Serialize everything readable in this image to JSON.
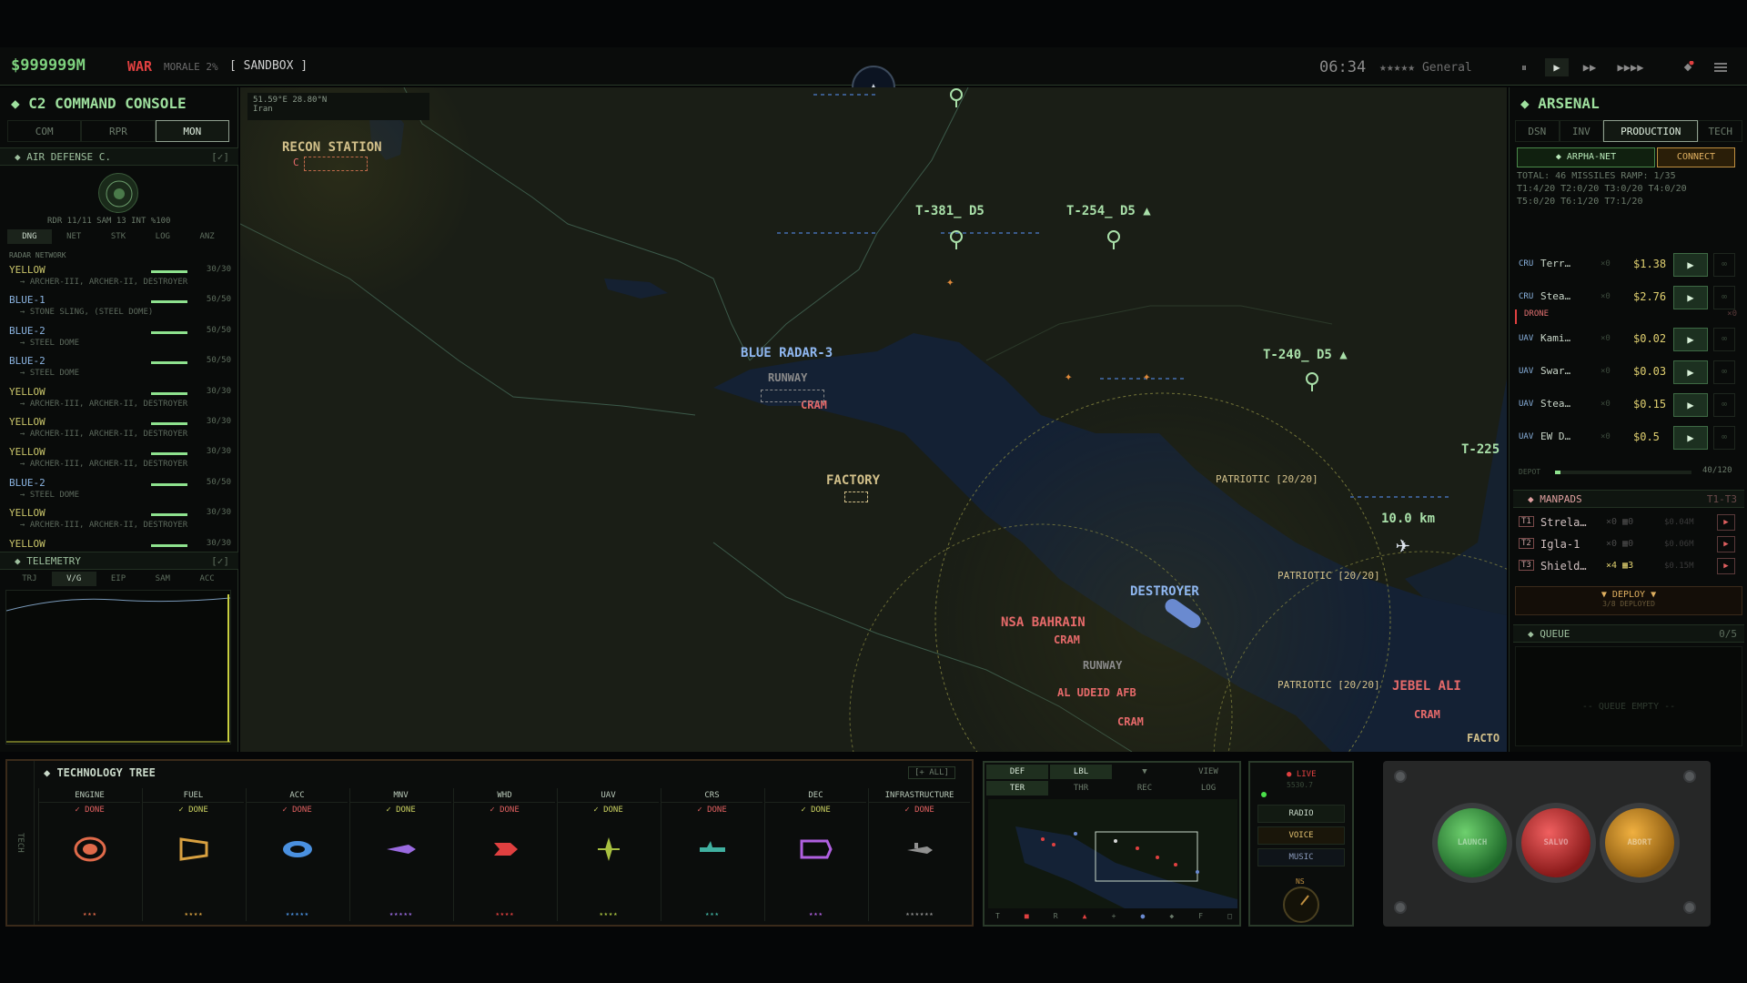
{
  "topbar": {
    "money": "$999999M",
    "war": "WAR",
    "morale": "MORALE 2%",
    "mode": "[ SANDBOX ]",
    "clock": "06:34",
    "rank": "★★★★★ General",
    "controls": [
      "⏸",
      "▶",
      "▶▶",
      "▶▶▶▶"
    ],
    "menu_icon": "menu-icon",
    "alert_icon": "satellite-icon"
  },
  "left": {
    "title": "C2 COMMAND CONSOLE",
    "tabs": [
      "COM",
      "RPR",
      "MON"
    ],
    "active_tab": 2,
    "section": "AIR DEFENSE C.",
    "section_check": "[✓]",
    "status_line": "RDR 11/11  SAM 13  INT %100",
    "subtabs": [
      "DNG",
      "NET",
      "STK",
      "LOG",
      "ANZ"
    ],
    "radar_header": "RADAR NETWORK",
    "radars": [
      {
        "name": "YELLOW",
        "val": "30/30",
        "sub": "→ ARCHER-III, ARCHER-II, DESTROYER",
        "blue": false
      },
      {
        "name": "BLUE-1",
        "val": "50/50",
        "sub": "→ STONE SLING, (STEEL DOME)",
        "blue": true
      },
      {
        "name": "BLUE-2",
        "val": "50/50",
        "sub": "→ STEEL DOME",
        "blue": true
      },
      {
        "name": "BLUE-2",
        "val": "50/50",
        "sub": "→ STEEL DOME",
        "blue": true
      },
      {
        "name": "YELLOW",
        "val": "30/30",
        "sub": "→ ARCHER-III, ARCHER-II, DESTROYER",
        "blue": false
      },
      {
        "name": "YELLOW",
        "val": "30/30",
        "sub": "→ ARCHER-III, ARCHER-II, DESTROYER",
        "blue": false
      },
      {
        "name": "YELLOW",
        "val": "30/30",
        "sub": "→ ARCHER-III, ARCHER-II, DESTROYER",
        "blue": false
      },
      {
        "name": "BLUE-2",
        "val": "50/50",
        "sub": "→ STEEL DOME",
        "blue": true
      },
      {
        "name": "YELLOW",
        "val": "30/30",
        "sub": "→ ARCHER-III, ARCHER-II, DESTROYER",
        "blue": false
      },
      {
        "name": "YELLOW",
        "val": "30/30",
        "sub": "",
        "blue": false
      }
    ],
    "telemetry": "TELEMETRY",
    "telemetry_check": "[✓]",
    "tele_tabs": [
      "TRJ",
      "V/G",
      "EIP",
      "SAM",
      "ACC"
    ]
  },
  "map": {
    "coords": "51.59°E 28.80°N",
    "country": "Iran",
    "labels": {
      "recon": "RECON STATION",
      "t381": "T-381_ D5",
      "t254": "T-254_ D5 ▲",
      "t240": "T-240_ D5 ▲",
      "t225": "T-225",
      "blue_radar": "BLUE RADAR-3",
      "runway1": "RUNWAY",
      "cram1": "CRAM",
      "factory": "FACTORY",
      "patriot1": "PATRIOTIC [20/20]",
      "patriot2": "PATRIOTIC [20/20]",
      "patriot3": "PATRIOTIC [20/20]",
      "distance": "10.0 km",
      "destroyer": "DESTROYER",
      "nsa": "NSA BAHRAIN",
      "cram2": "CRAM",
      "runway2": "RUNWAY",
      "afb": "AL UDEID AFB",
      "cram3": "CRAM",
      "jebel": "JEBEL ALI",
      "cram4": "CRAM",
      "facto": "FACTO",
      "c_mark": "C"
    }
  },
  "right": {
    "title": "ARSENAL",
    "tabs": [
      "DSN",
      "INV",
      "PRODUCTION",
      "TECH"
    ],
    "active_tab": 2,
    "net": "◆ ARPHA-NET",
    "connect": "CONNECT",
    "totals1": "TOTAL: 46 MISSILES RAMP: 1/35",
    "totals2": "T1:4/20 T2:0/20 T3:0/20 T4:0/20",
    "totals3": "T5:0/20 T6:1/20 T7:1/20",
    "cruise": [
      {
        "type": "CRU",
        "name": "Terr…",
        "cnt": "×0",
        "price": "$1.38"
      },
      {
        "type": "CRU",
        "name": "Stea…",
        "cnt": "×0",
        "price": "$2.76"
      }
    ],
    "drone_header": "DRONE",
    "drone_count": "×0",
    "drones": [
      {
        "type": "UAV",
        "name": "Kami…",
        "cnt": "×0",
        "price": "$0.02"
      },
      {
        "type": "UAV",
        "name": "Swar…",
        "cnt": "×0",
        "price": "$0.03"
      },
      {
        "type": "UAV",
        "name": "Stea…",
        "cnt": "×0",
        "price": "$0.15"
      },
      {
        "type": "UAV",
        "name": "EW D…",
        "cnt": "×0",
        "price": "$0.5"
      }
    ],
    "depot": "DEPOT",
    "depot_val": "40/120",
    "depot_fraction": 0.04,
    "manpads": "MANPADS",
    "manpads_tier": "T1-T3",
    "manpad_rows": [
      {
        "tier": "T1",
        "name": "Strela…",
        "cnt": "×0 ▦0",
        "price": "$0.04M"
      },
      {
        "tier": "T2",
        "name": "Igla-1",
        "cnt": "×0 ▦0",
        "price": "$0.06M"
      },
      {
        "tier": "T3",
        "name": "Shield…",
        "cnt": "×4 ▦3",
        "price": "$0.15M"
      }
    ],
    "deploy": "▼ DEPLOY ▼",
    "deployed": "3/8 DEPLOYED",
    "queue": "QUEUE",
    "queue_count": "0/5",
    "queue_empty": "-- QUEUE EMPTY --"
  },
  "tech": {
    "title": "TECHNOLOGY TREE",
    "all": "[+ ALL]",
    "side": "TECH",
    "columns": [
      {
        "name": "ENGINE",
        "status": "✓ DONE",
        "color": "#e06a4a",
        "stars": "★★★",
        "icon": "engine-icon"
      },
      {
        "name": "FUEL",
        "status": "✓ DONE",
        "color": "#d8a040",
        "stars": "★★★★",
        "icon": "fuel-icon"
      },
      {
        "name": "ACC",
        "status": "✓ DONE",
        "color": "#4a90e0",
        "stars": "★★★★★",
        "icon": "accuracy-icon"
      },
      {
        "name": "MNV",
        "status": "✓ DONE",
        "color": "#9a6ae0",
        "stars": "★★★★★",
        "icon": "maneuver-icon"
      },
      {
        "name": "WHD",
        "status": "✓ DONE",
        "color": "#e04040",
        "stars": "★★★★",
        "icon": "warhead-icon"
      },
      {
        "name": "UAV",
        "status": "✓ DONE",
        "color": "#a8c040",
        "stars": "★★★★",
        "icon": "uav-icon"
      },
      {
        "name": "CRS",
        "status": "✓ DONE",
        "color": "#40b0a0",
        "stars": "★★★",
        "icon": "cruise-icon"
      },
      {
        "name": "DEC",
        "status": "✓ DONE",
        "color": "#b060e0",
        "stars": "★★★",
        "icon": "decoy-icon"
      },
      {
        "name": "INFRASTRUCTURE",
        "status": "✓ DONE",
        "color": "#909090",
        "stars": "★★★★★★",
        "icon": "infrastructure-icon"
      }
    ]
  },
  "minimap": {
    "tabs1": [
      "DEF",
      "LBL",
      "▼",
      "VIEW"
    ],
    "tabs2": [
      "TER",
      "THR",
      "REC",
      "LOG"
    ],
    "bottom": [
      "T",
      "■",
      "R",
      "▲",
      "+",
      "●",
      "◆",
      "F",
      "□"
    ]
  },
  "radio": {
    "live": "● LIVE",
    "freq": "5530.7",
    "radio": "RADIO",
    "voice": "VOICE",
    "music": "MUSIC",
    "ns": "NS"
  },
  "console": {
    "green": "LAUNCH",
    "red": "SALVO",
    "amber": "ABORT"
  }
}
